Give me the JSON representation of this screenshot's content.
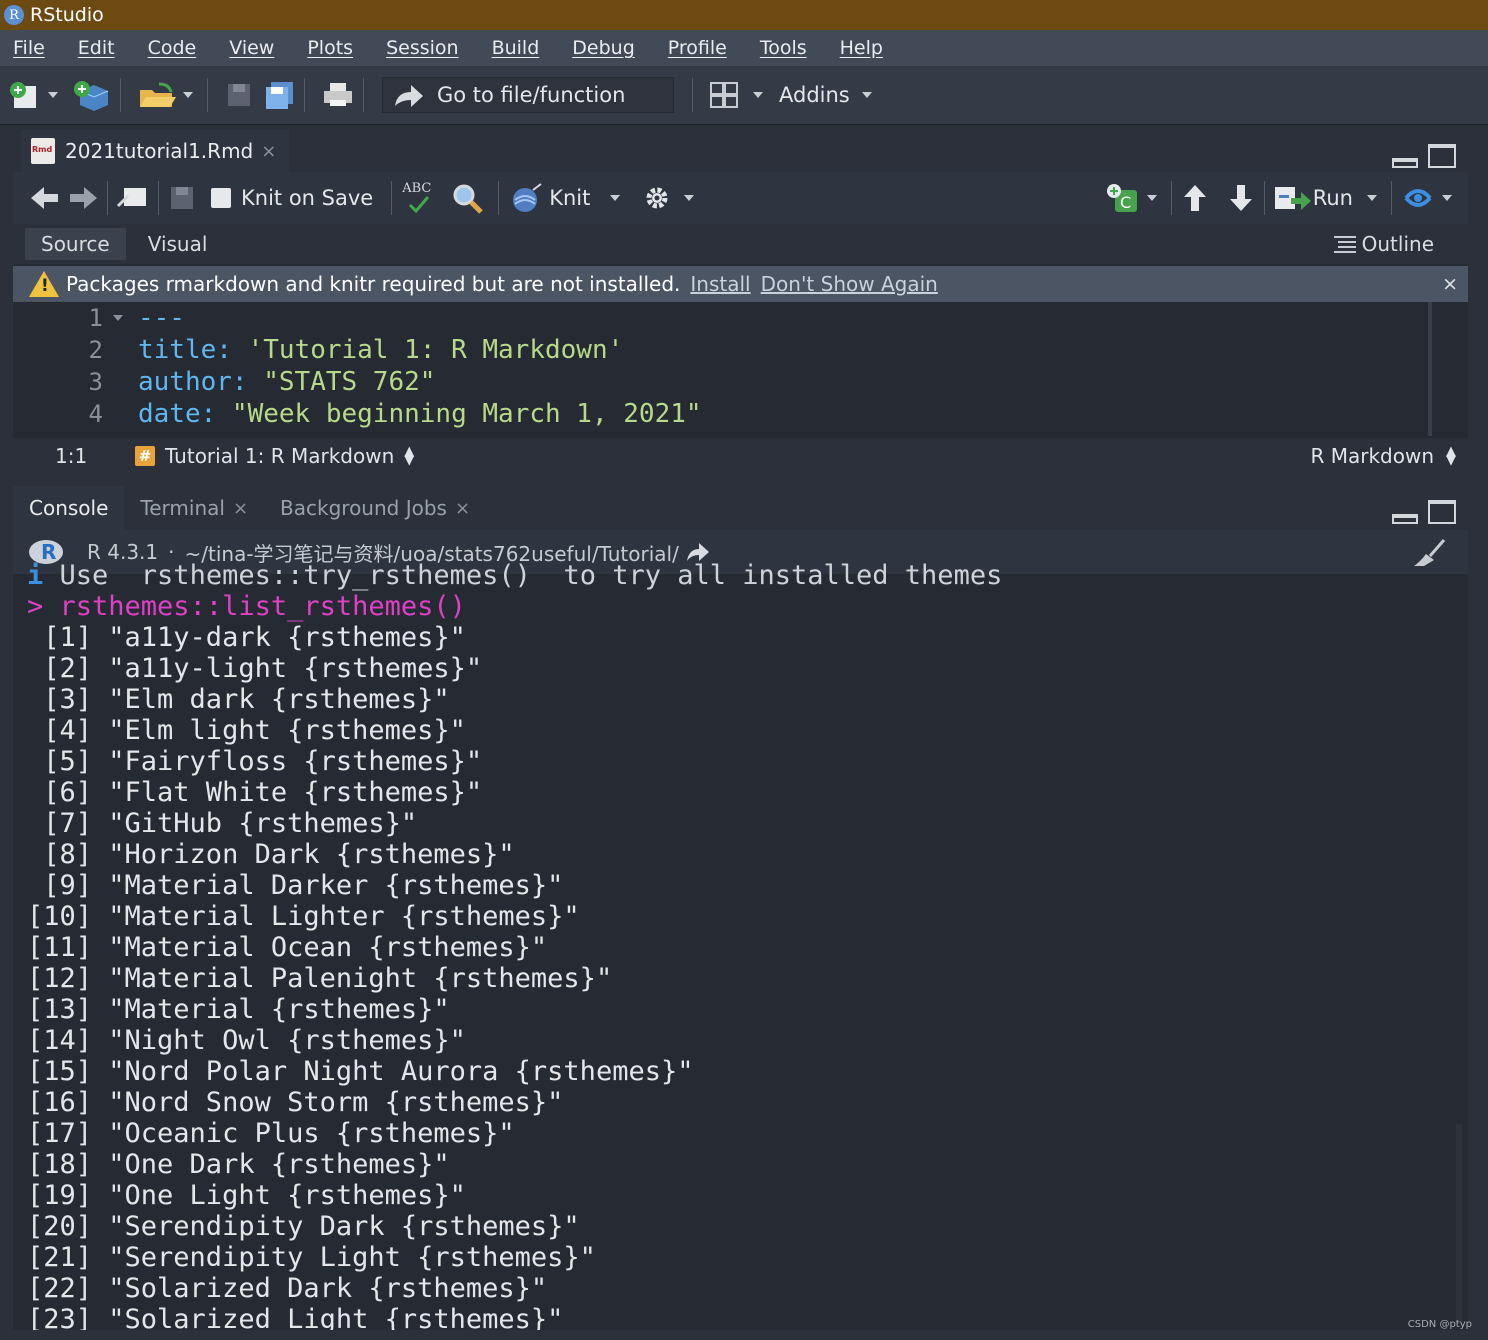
{
  "window": {
    "title": "RStudio",
    "logo_letter": "R"
  },
  "menu": [
    "File",
    "Edit",
    "Code",
    "View",
    "Plots",
    "Session",
    "Build",
    "Debug",
    "Profile",
    "Tools",
    "Help"
  ],
  "toolbar": {
    "goto_label": "Go to file/function",
    "addins_label": "Addins"
  },
  "editor": {
    "tab_name": "2021tutorial1.Rmd",
    "tab_close": "×",
    "knit_on_save": "Knit on Save",
    "spell_label": "ABC",
    "knit": "Knit",
    "run": "Run",
    "source_tab": "Source",
    "visual_tab": "Visual",
    "outline": "Outline",
    "warning": {
      "message": "Packages rmarkdown and knitr required but are not installed.",
      "install": "Install",
      "dont_show": "Don't Show Again",
      "close": "×"
    },
    "lines": [
      {
        "n": "1",
        "key": "---",
        "val": ""
      },
      {
        "n": "2",
        "key": "title:",
        "val": " 'Tutorial 1: R Markdown'"
      },
      {
        "n": "3",
        "key": "author:",
        "val": " \"STATS 762\""
      },
      {
        "n": "4",
        "key": "date:",
        "val": " \"Week beginning March 1, 2021\""
      }
    ],
    "status": {
      "position": "1:1",
      "section": "Tutorial 1: R Markdown",
      "section_icon": "#",
      "mode": "R Markdown"
    }
  },
  "console": {
    "tabs": [
      "Console",
      "Terminal",
      "Background Jobs"
    ],
    "tab_close": "×",
    "r_version": "R 4.3.1",
    "separator": "·",
    "path": "~/tina-学习笔记与资料/uoa/stats762useful/Tutorial/",
    "info_marker": "i",
    "info_line": " Use  rsthemes::try_rsthemes()  to try all installed themes",
    "prompt": ">",
    "command": " rsthemes::list_rsthemes()",
    "results": [
      " [1] \"a11y-dark {rsthemes}\"",
      " [2] \"a11y-light {rsthemes}\"",
      " [3] \"Elm dark {rsthemes}\"",
      " [4] \"Elm light {rsthemes}\"",
      " [5] \"Fairyfloss {rsthemes}\"",
      " [6] \"Flat White {rsthemes}\"",
      " [7] \"GitHub {rsthemes}\"",
      " [8] \"Horizon Dark {rsthemes}\"",
      " [9] \"Material Darker {rsthemes}\"",
      "[10] \"Material Lighter {rsthemes}\"",
      "[11] \"Material Ocean {rsthemes}\"",
      "[12] \"Material Palenight {rsthemes}\"",
      "[13] \"Material {rsthemes}\"",
      "[14] \"Night Owl {rsthemes}\"",
      "[15] \"Nord Polar Night Aurora {rsthemes}\"",
      "[16] \"Nord Snow Storm {rsthemes}\"",
      "[17] \"Oceanic Plus {rsthemes}\"",
      "[18] \"One Dark {rsthemes}\"",
      "[19] \"One Light {rsthemes}\"",
      "[20] \"Serendipity Dark {rsthemes}\"",
      "[21] \"Serendipity Light {rsthemes}\"",
      "[22] \"Solarized Dark {rsthemes}\"",
      "[23] \"Solarized Light {rsthemes}\""
    ]
  },
  "watermark": "CSDN @ptyp",
  "colors": {
    "titlebar": "#6e4a13",
    "prompt": "#e040c8",
    "yaml_key": "#5fb6f0",
    "yaml_value": "#b7d989",
    "warning": "#f0c33c"
  }
}
